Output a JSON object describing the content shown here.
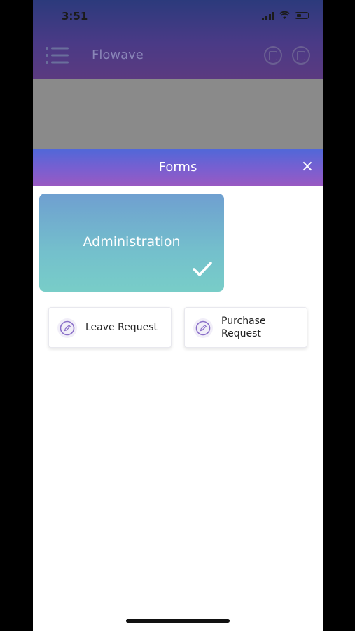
{
  "status_bar": {
    "time": "3:51"
  },
  "header": {
    "app_title": "Flowave"
  },
  "sheet": {
    "title": "Forms",
    "close_label": "×"
  },
  "category": {
    "label": "Administration",
    "selected": true
  },
  "forms": [
    {
      "label": "Leave Request"
    },
    {
      "label": "Purchase Request"
    }
  ],
  "colors": {
    "sheet_header_start": "#5068d8",
    "sheet_header_end": "#9a59c2",
    "category_start": "#6f9fd0",
    "category_end": "#78cdc8",
    "form_icon_accent": "#8a6fc8"
  },
  "icons": {
    "menu": "menu-icon",
    "close": "close-icon",
    "check": "check-icon",
    "form": "edit-icon"
  }
}
